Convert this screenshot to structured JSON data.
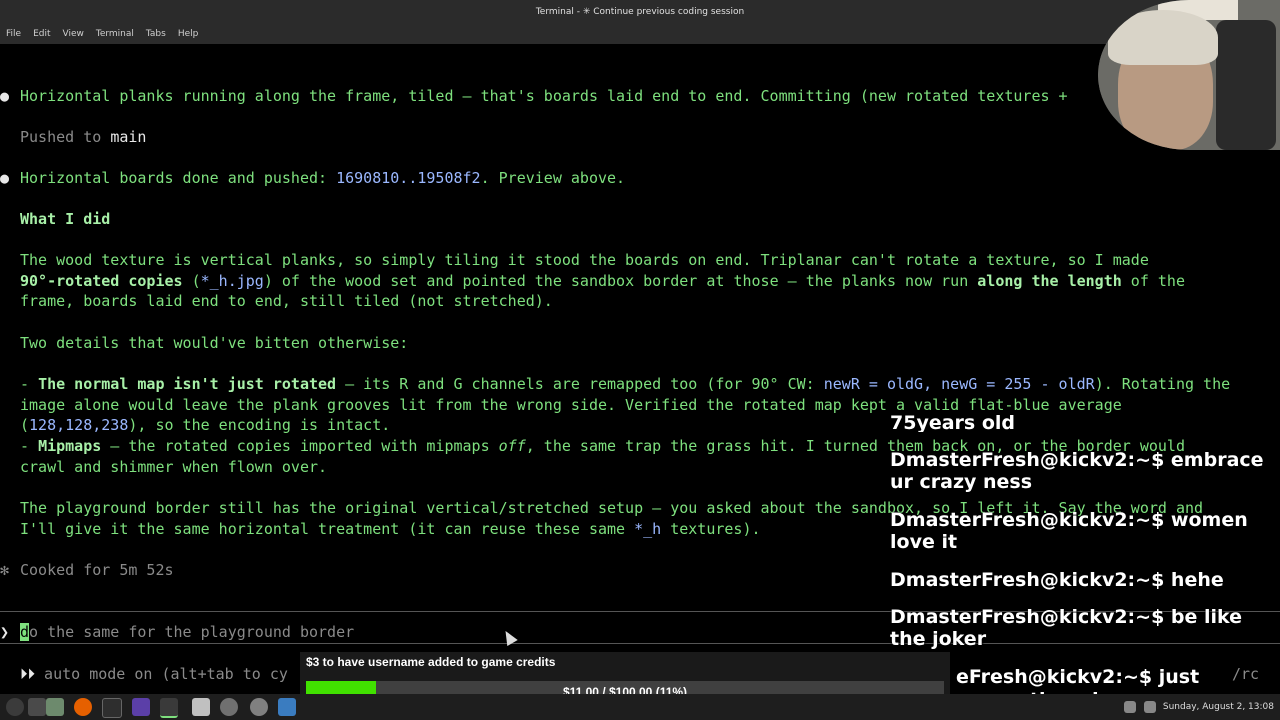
{
  "window": {
    "title": "Terminal - ✳ Continue previous coding session"
  },
  "menu": [
    "File",
    "Edit",
    "View",
    "Terminal",
    "Tabs",
    "Help"
  ],
  "terminal": {
    "l1": "Horizontal planks running along the frame, tiled — that's boards laid end to end. Committing (new rotated textures +",
    "l2a": "Pushed to ",
    "l2b": "main",
    "l3a": "Horizontal boards done and pushed: ",
    "l3b": "1690810..19508f2",
    "l3c": ". Preview above.",
    "l4": "What I did",
    "l5": "The wood texture is vertical planks, so simply tiling it stood the boards on end. Triplanar can't rotate a texture, so I made",
    "l6a": "90°-rotated copies",
    "l6b": " (",
    "l6c": "*_h.jpg",
    "l6d": ") of the wood set and pointed the sandbox border at those — the planks now run ",
    "l6e": "along the length",
    "l6f": " of the",
    "l7": "frame, boards laid end to end, still tiled (not stretched).",
    "l8": "Two details that would've bitten otherwise:",
    "l9a": "- ",
    "l9b": "The normal map isn't just rotated",
    "l9c": " — its R and G channels are remapped too (for 90° CW: ",
    "l9d": "newR = oldG, newG = 255 - oldR",
    "l9e": "). Rotating the",
    "l10": "image alone would leave the plank grooves lit from the wrong side. Verified the rotated map kept a valid flat-blue average",
    "l11a": "(",
    "l11b": "128,128,238",
    "l11c": "), so the encoding is intact.",
    "l12a": "- ",
    "l12b": "Mipmaps",
    "l12c": " — the rotated copies imported with mipmaps ",
    "l12d": "off",
    "l12e": ", the same trap the grass hit. I turned them back on, or the border would",
    "l13": "crawl and shimmer when flown over.",
    "l14a": "The playground border still has the original vertical/stretched setup — you asked about the sandbox, so I left it. Say the word and",
    "l15a": "I'll give it the same horizontal treatment (it can reuse these same ",
    "l15b": "*_h",
    "l15c": " textures).",
    "cooked": "Cooked for 5m 52s",
    "prompt_caret": "❯",
    "prompt_first": "d",
    "prompt_rest": "o the same for the playground border",
    "auto_mode_arrows": "⏵⏵",
    "auto_mode": " auto mode on (alt+tab to cy",
    "rc": "/rc"
  },
  "chat": [
    {
      "user": "",
      "msg": "75years old"
    },
    {
      "user": "DmasterFresh@kickv2:~$",
      "msg": " embrace ur crazy ness"
    },
    {
      "user": "DmasterFresh@kickv2:~$",
      "msg": " women love it"
    },
    {
      "user": "DmasterFresh@kickv2:~$",
      "msg": " hehe"
    },
    {
      "user": "DmasterFresh@kickv2:~$",
      "msg": " be like the joker"
    },
    {
      "user": "",
      "msg": "eFresh@kickv2:~$ just"
    },
    {
      "user": "",
      "msg": "o over the edge"
    }
  ],
  "donation": {
    "title": "$3 to have username added to game credits",
    "amount": "$11.00 / $100.00 (11%)",
    "progress": 0.11,
    "color": "#41e100"
  },
  "taskbar": {
    "clock": "Sunday, August  2, 13:08"
  }
}
